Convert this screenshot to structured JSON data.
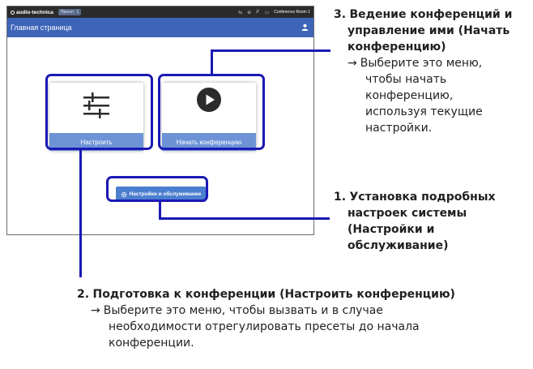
{
  "app": {
    "brand": "audio-technica",
    "preset_label": "Пресет",
    "preset_number": "1",
    "room_name": "Conference Room 1",
    "page_title": "Главная страница"
  },
  "tiles": {
    "setup_label": "Настроить",
    "start_label": "Начать конференцию"
  },
  "maintenance_button": "Настройки и обслуживание",
  "annotations": {
    "a3": {
      "num": "3.",
      "line1": "Ведение конференций и",
      "line2": "управление ими (Начать",
      "line3": "конференцию)",
      "arrow": "→",
      "desc1": "Выберите это меню,",
      "desc2": "чтобы начать",
      "desc3": "конференцию,",
      "desc4": "используя текущие",
      "desc5": "настройки."
    },
    "a1": {
      "num": "1.",
      "line1": "Установка подробных",
      "line2": "настроек системы",
      "line3": "(Настройки и",
      "line4": "обслуживание)"
    },
    "a2": {
      "num": "2.",
      "line1": "Подготовка к конференции (Настроить конференцию)",
      "arrow": "→",
      "desc1": "Выберите это меню, чтобы вызвать и в случае",
      "desc2": "необходимости отрегулировать пресеты до начала",
      "desc3": "конференции."
    }
  },
  "colors": {
    "annotation_blue": "#1a19b5",
    "title_bar": "#3e64b8",
    "tile_label": "#6d93d6",
    "button": "#4c7ed0"
  }
}
